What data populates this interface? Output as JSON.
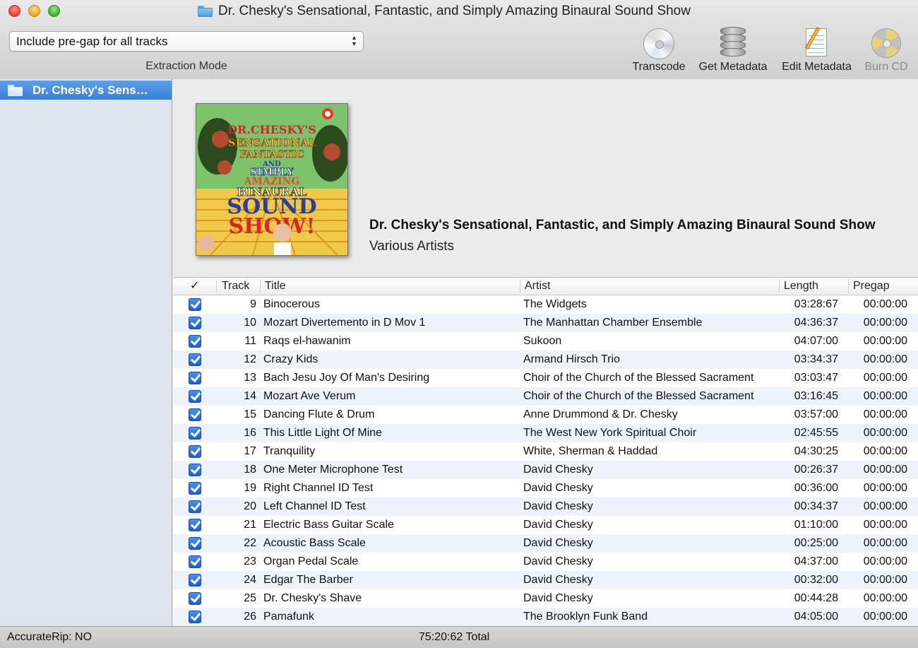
{
  "window": {
    "title": "Dr. Chesky's Sensational, Fantastic, and Simply Amazing Binaural Sound Show"
  },
  "toolbar": {
    "extraction_mode_value": "Include pre-gap for all tracks",
    "extraction_mode_label": "Extraction Mode",
    "transcode_label": "Transcode",
    "get_metadata_label": "Get Metadata",
    "edit_metadata_label": "Edit Metadata",
    "burn_cd_label": "Burn CD"
  },
  "sidebar": {
    "items": [
      {
        "label": "Dr. Chesky's Sens…",
        "selected": true
      }
    ]
  },
  "album": {
    "title": "Dr. Chesky's Sensational, Fantastic, and Simply Amazing Binaural Sound Show",
    "artist": "Various Artists",
    "cover_text": {
      "line1": "DR.CHESKY'S",
      "line2": "SENSATIONAL",
      "line3": "FANTASTIC",
      "line4": "AND",
      "line5": "SIMPLY",
      "line6": "AMAZING",
      "line7": "BINAURAL",
      "line8": "SOUND",
      "line9": "SHOW!"
    }
  },
  "table": {
    "headers": {
      "check": "✓",
      "track": "Track",
      "title": "Title",
      "artist": "Artist",
      "length": "Length",
      "pregap": "Pregap"
    },
    "rows": [
      {
        "checked": true,
        "track": "9",
        "title": "Binocerous",
        "artist": "The Widgets",
        "length": "03:28:67",
        "pregap": "00:00:00"
      },
      {
        "checked": true,
        "track": "10",
        "title": "Mozart Divertemento in D Mov 1",
        "artist": "The Manhattan Chamber Ensemble",
        "length": "04:36:37",
        "pregap": "00:00:00"
      },
      {
        "checked": true,
        "track": "11",
        "title": "Raqs el-hawanim",
        "artist": "Sukoon",
        "length": "04:07:00",
        "pregap": "00:00:00"
      },
      {
        "checked": true,
        "track": "12",
        "title": "Crazy Kids",
        "artist": "Armand Hirsch Trio",
        "length": "03:34:37",
        "pregap": "00:00:00"
      },
      {
        "checked": true,
        "track": "13",
        "title": "Bach Jesu Joy Of Man's Desiring",
        "artist": "Choir of the Church of the Blessed Sacrament",
        "length": "03:03:47",
        "pregap": "00:00:00"
      },
      {
        "checked": true,
        "track": "14",
        "title": "Mozart Ave Verum",
        "artist": "Choir of the Church of the Blessed Sacrament",
        "length": "03:16:45",
        "pregap": "00:00:00"
      },
      {
        "checked": true,
        "track": "15",
        "title": "Dancing Flute & Drum",
        "artist": "Anne Drummond & Dr. Chesky",
        "length": "03:57:00",
        "pregap": "00:00:00"
      },
      {
        "checked": true,
        "track": "16",
        "title": "This Little Light Of Mine",
        "artist": "The West New York Spiritual Choir",
        "length": "02:45:55",
        "pregap": "00:00:00"
      },
      {
        "checked": true,
        "track": "17",
        "title": "Tranquility",
        "artist": "White, Sherman & Haddad",
        "length": "04:30:25",
        "pregap": "00:00:00"
      },
      {
        "checked": true,
        "track": "18",
        "title": "One Meter Microphone Test",
        "artist": "David Chesky",
        "length": "00:26:37",
        "pregap": "00:00:00"
      },
      {
        "checked": true,
        "track": "19",
        "title": "Right Channel ID Test",
        "artist": "David Chesky",
        "length": "00:36:00",
        "pregap": "00:00:00"
      },
      {
        "checked": true,
        "track": "20",
        "title": "Left Channel ID Test",
        "artist": "David Chesky",
        "length": "00:34:37",
        "pregap": "00:00:00"
      },
      {
        "checked": true,
        "track": "21",
        "title": "Electric Bass Guitar Scale",
        "artist": "David Chesky",
        "length": "01:10:00",
        "pregap": "00:00:00"
      },
      {
        "checked": true,
        "track": "22",
        "title": "Acoustic Bass Scale",
        "artist": "David Chesky",
        "length": "00:25:00",
        "pregap": "00:00:00"
      },
      {
        "checked": true,
        "track": "23",
        "title": "Organ Pedal Scale",
        "artist": "David Chesky",
        "length": "04:37:00",
        "pregap": "00:00:00"
      },
      {
        "checked": true,
        "track": "24",
        "title": "Edgar The Barber",
        "artist": "David Chesky",
        "length": "00:32:00",
        "pregap": "00:00:00"
      },
      {
        "checked": true,
        "track": "25",
        "title": "Dr. Chesky's Shave",
        "artist": "David Chesky",
        "length": "00:44:28",
        "pregap": "00:00:00"
      },
      {
        "checked": true,
        "track": "26",
        "title": "Pamafunk",
        "artist": "The Brooklyn Funk Band",
        "length": "04:05:00",
        "pregap": "00:00:00"
      }
    ]
  },
  "status": {
    "accuraterip": "AccurateRip:  NO",
    "total": "75:20:62 Total"
  },
  "colors": {
    "selection_blue": "#3a7fd6",
    "row_alt": "#eef3fb",
    "checkbox_blue": "#1c5fcf"
  }
}
